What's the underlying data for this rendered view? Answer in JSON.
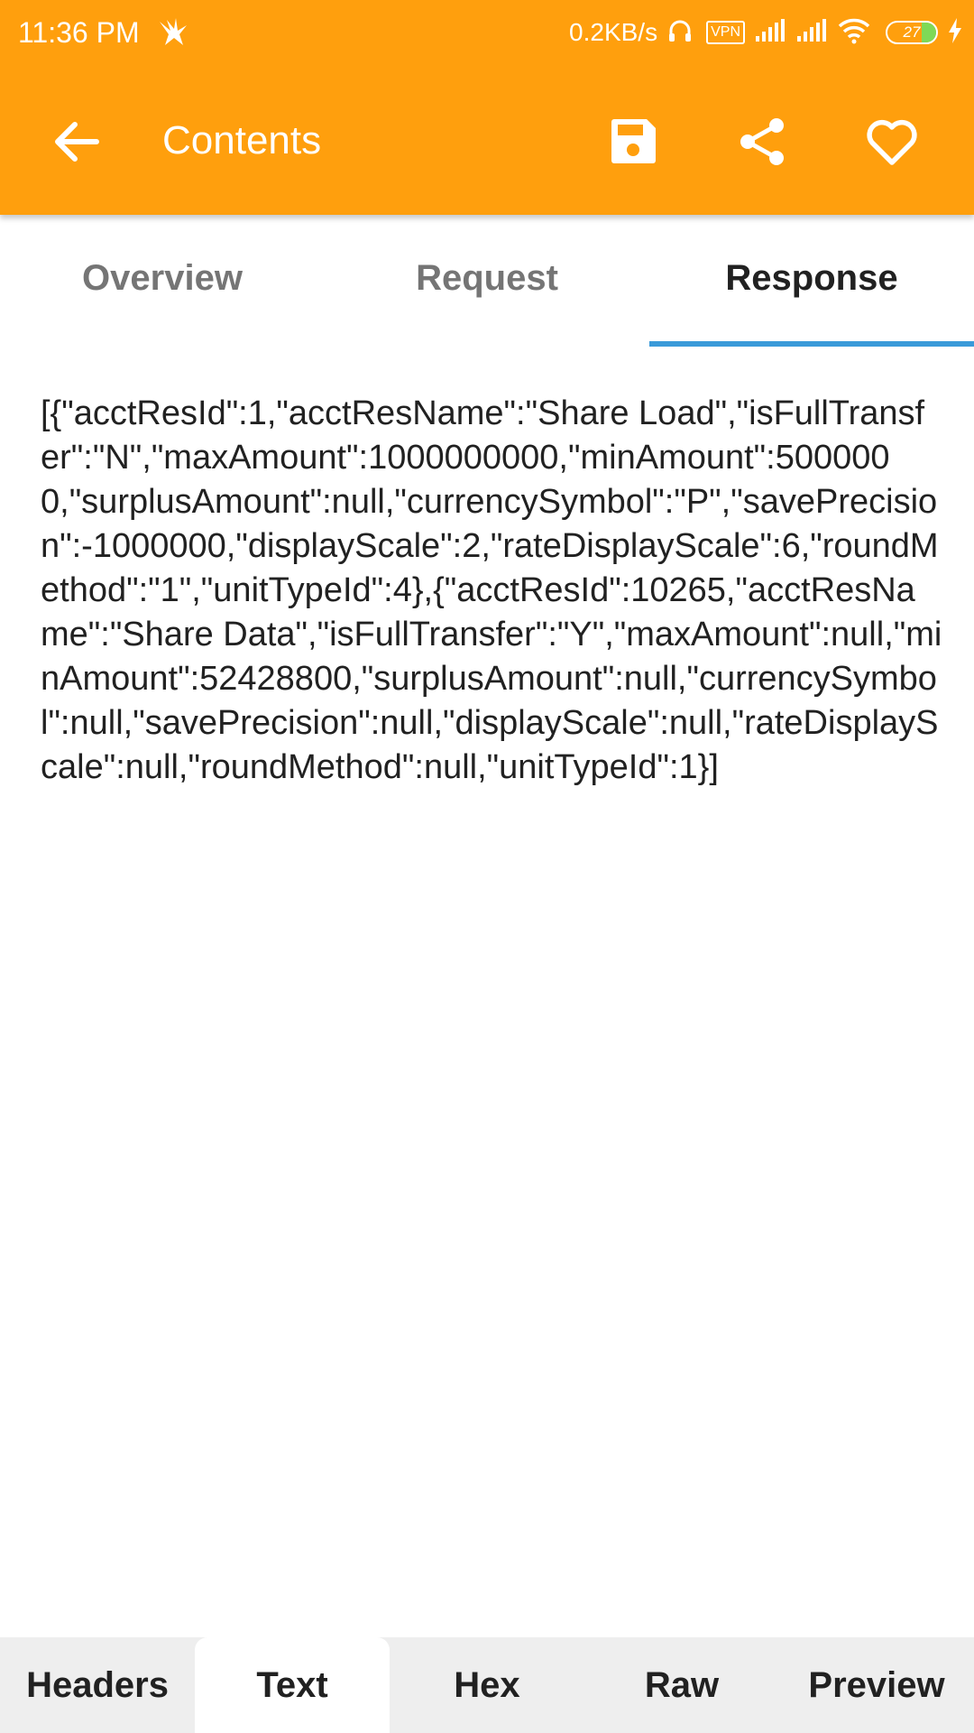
{
  "status_bar": {
    "time": "11:36 PM",
    "net_speed": "0.2KB/s",
    "vpn_label": "VPN",
    "battery_level": "27",
    "icons": [
      "bird-app-icon",
      "headphones-icon",
      "vpn-icon",
      "signal-icon",
      "signal-icon",
      "wifi-icon",
      "battery-icon",
      "charging-icon"
    ]
  },
  "toolbar": {
    "title": "Contents",
    "back_icon": "arrow-left-icon",
    "actions": [
      {
        "name": "save",
        "icon": "floppy-save-icon"
      },
      {
        "name": "share",
        "icon": "share-icon"
      },
      {
        "name": "favorite",
        "icon": "heart-outline-icon"
      }
    ]
  },
  "tabs": [
    {
      "label": "Overview",
      "active": false
    },
    {
      "label": "Request",
      "active": false
    },
    {
      "label": "Response",
      "active": true
    }
  ],
  "response_body": "[{\"acctResId\":1,\"acctResName\":\"Share Load\",\"isFullTransfer\":\"N\",\"maxAmount\":1000000000,\"minAmount\":5000000,\"surplusAmount\":null,\"currencySymbol\":\"P\",\"savePrecision\":-1000000,\"displayScale\":2,\"rateDisplayScale\":6,\"roundMethod\":\"1\",\"unitTypeId\":4},{\"acctResId\":10265,\"acctResName\":\"Share Data\",\"isFullTransfer\":\"Y\",\"maxAmount\":null,\"minAmount\":52428800,\"surplusAmount\":null,\"currencySymbol\":null,\"savePrecision\":null,\"displayScale\":null,\"rateDisplayScale\":null,\"roundMethod\":null,\"unitTypeId\":1}]",
  "bottom_tabs": [
    {
      "label": "Headers",
      "active": false
    },
    {
      "label": "Text",
      "active": true
    },
    {
      "label": "Hex",
      "active": false
    },
    {
      "label": "Raw",
      "active": false
    },
    {
      "label": "Preview",
      "active": false
    }
  ],
  "colors": {
    "app_bar": "#FF9F0D",
    "tab_indicator": "#3A9AD9",
    "bottom_bar": "#EEEEEE"
  }
}
